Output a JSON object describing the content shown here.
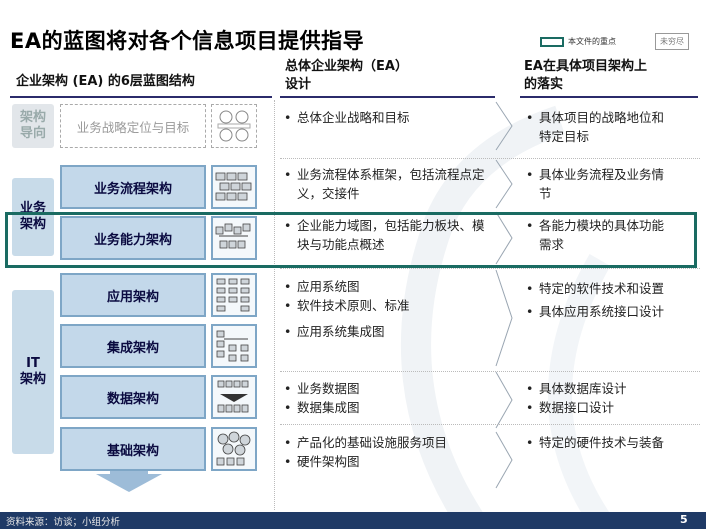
{
  "title": "EA的蓝图将对各个信息项目提供指导",
  "legend": {
    "label": "本文件的重点"
  },
  "stamp": "未穷尽",
  "headers": {
    "col1": "企业架构 (EA) 的6层蓝图结构",
    "col2_line1": "总体企业架构（EA）",
    "col2_line2": "设计",
    "col3_line1": "EA在具体项目架构上",
    "col3_line2": "的落实"
  },
  "groups": {
    "arch_guide_1": "架构",
    "arch_guide_2": "导向",
    "business_1": "业务",
    "business_2": "架构",
    "it_1": "IT",
    "it_2": "架构"
  },
  "rows": [
    {
      "layer": "业务战略定位与目标",
      "icon": "target-diagram-icon",
      "ea": [
        "总体企业战略和目标"
      ],
      "project": [
        "具体项目的战略地位和特定目标"
      ]
    },
    {
      "layer": "业务流程架构",
      "icon": "process-flow-icon",
      "ea": [
        "业务流程体系框架，包括流程点定义，交接件"
      ],
      "project": [
        "具体业务流程及业务情节"
      ]
    },
    {
      "layer": "业务能力架构",
      "icon": "capability-blocks-icon",
      "ea": [
        "企业能力域图，包括能力板块、模块与功能点概述"
      ],
      "project": [
        "各能力模块的具体功能需求"
      ]
    },
    {
      "layer": "应用架构",
      "icon": "application-map-icon",
      "ea": [
        "应用系统图",
        "软件技术原则、标准",
        "应用系统集成图"
      ],
      "project": [
        "特定的软件技术和设置",
        "具体应用系统接口设计"
      ]
    },
    {
      "layer": "集成架构",
      "icon": "integration-icon",
      "ea": [],
      "project": []
    },
    {
      "layer": "数据架构",
      "icon": "data-model-icon",
      "ea": [
        "业务数据图",
        "数据集成图"
      ],
      "project": [
        "具体数据库设计",
        "数据接口设计"
      ]
    },
    {
      "layer": "基础架构",
      "icon": "infrastructure-icon",
      "ea": [
        "产品化的基础设施服务项目",
        "硬件架构图"
      ],
      "project": [
        "特定的硬件技术与装备"
      ]
    }
  ],
  "footer": {
    "source": "资料来源：访谈；小组分析",
    "page": "5"
  },
  "colors": {
    "accent": "#1a6b62",
    "box_fill": "#c3d8ea",
    "footer": "#1f3a66"
  }
}
